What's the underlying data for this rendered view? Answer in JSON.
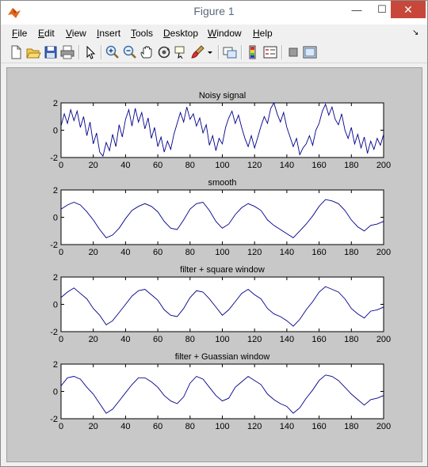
{
  "window": {
    "title": "Figure 1",
    "minimize_glyph": "—",
    "maximize_glyph": "☐",
    "close_glyph": "✕"
  },
  "menu": {
    "items": [
      {
        "label": "File",
        "accel": "F"
      },
      {
        "label": "Edit",
        "accel": "E"
      },
      {
        "label": "View",
        "accel": "V"
      },
      {
        "label": "Insert",
        "accel": "I"
      },
      {
        "label": "Tools",
        "accel": "T"
      },
      {
        "label": "Desktop",
        "accel": "D"
      },
      {
        "label": "Window",
        "accel": "W"
      },
      {
        "label": "Help",
        "accel": "H"
      }
    ],
    "overflow_glyph": "↘"
  },
  "toolbar": {
    "icons": [
      "new-figure-icon",
      "open-file-icon",
      "save-icon",
      "print-icon",
      "edit-plot-arrow-icon",
      "zoom-in-icon",
      "zoom-out-icon",
      "pan-hand-icon",
      "rotate-3d-icon",
      "data-cursor-icon",
      "brush-icon",
      "brush-dropdown-icon",
      "link-plot-icon",
      "colorbar-icon",
      "legend-icon",
      "hide-plot-tools-icon",
      "show-plot-tools-icon"
    ]
  },
  "colors": {
    "line": "#00008b",
    "figure_bg": "#c8c8c8",
    "axes_bg": "#ffffff",
    "close_button": "#c7473b"
  },
  "chart_data": [
    {
      "type": "line",
      "title": "Noisy signal",
      "xlim": [
        0,
        200
      ],
      "ylim": [
        -2,
        2
      ],
      "xticks": [
        0,
        20,
        40,
        60,
        80,
        100,
        120,
        140,
        160,
        180,
        200
      ],
      "yticks": [
        -2,
        0,
        2
      ],
      "series": [
        {
          "x": [
            0,
            2,
            4,
            6,
            8,
            10,
            12,
            14,
            16,
            18,
            20,
            22,
            24,
            26,
            28,
            30,
            32,
            34,
            36,
            38,
            40,
            42,
            44,
            46,
            48,
            50,
            52,
            54,
            56,
            58,
            60,
            62,
            64,
            66,
            68,
            70,
            72,
            74,
            76,
            78,
            80,
            82,
            84,
            86,
            88,
            90,
            92,
            94,
            96,
            98,
            100,
            102,
            104,
            106,
            108,
            110,
            112,
            114,
            116,
            118,
            120,
            122,
            124,
            126,
            128,
            130,
            132,
            134,
            136,
            138,
            140,
            142,
            144,
            146,
            148,
            150,
            152,
            154,
            156,
            158,
            160,
            162,
            164,
            166,
            168,
            170,
            172,
            174,
            176,
            178,
            180,
            182,
            184,
            186,
            188,
            190,
            192,
            194,
            196,
            198,
            200
          ],
          "y": [
            0.3,
            1.2,
            0.5,
            1.5,
            0.7,
            1.4,
            0.2,
            1.0,
            -0.4,
            0.6,
            -1.0,
            -0.2,
            -1.6,
            -1.9,
            -0.9,
            -1.5,
            -0.3,
            -1.2,
            0.4,
            -0.5,
            0.8,
            1.5,
            0.3,
            1.6,
            0.6,
            1.3,
            0.1,
            0.9,
            -0.6,
            0.2,
            -1.2,
            -0.5,
            -1.6,
            -0.8,
            -1.4,
            -0.3,
            0.5,
            1.3,
            0.6,
            1.7,
            0.8,
            1.2,
            0.3,
            0.9,
            -0.2,
            0.4,
            -1.1,
            -0.4,
            -1.5,
            -0.6,
            -1.0,
            0.2,
            0.9,
            1.4,
            0.5,
            1.1,
            0.2,
            -0.6,
            -1.2,
            -0.4,
            -1.3,
            -0.5,
            0.3,
            1.0,
            0.5,
            1.6,
            2.0,
            1.2,
            0.6,
            1.3,
            0.2,
            -0.5,
            -1.2,
            -0.6,
            -1.8,
            -1.3,
            -1.0,
            -0.4,
            -1.1,
            0.0,
            0.5,
            1.4,
            1.9,
            1.1,
            1.7,
            0.8,
            0.4,
            1.2,
            0.0,
            -0.6,
            0.2,
            -1.0,
            -0.3,
            -1.3,
            -0.5,
            -1.7,
            -0.8,
            -1.4,
            -0.6,
            -1.1,
            -0.3
          ]
        }
      ]
    },
    {
      "type": "line",
      "title": "smooth",
      "xlim": [
        0,
        200
      ],
      "ylim": [
        -2,
        2
      ],
      "xticks": [
        0,
        20,
        40,
        60,
        80,
        100,
        120,
        140,
        160,
        180,
        200
      ],
      "yticks": [
        -2,
        0,
        2
      ],
      "series": [
        {
          "x": [
            0,
            4,
            8,
            12,
            16,
            20,
            24,
            28,
            32,
            36,
            40,
            44,
            48,
            52,
            56,
            60,
            64,
            68,
            72,
            76,
            80,
            84,
            88,
            92,
            96,
            100,
            104,
            108,
            112,
            116,
            120,
            124,
            128,
            132,
            136,
            140,
            144,
            148,
            152,
            156,
            160,
            164,
            168,
            172,
            176,
            180,
            184,
            188,
            192,
            196,
            200
          ],
          "y": [
            0.6,
            0.9,
            1.1,
            0.9,
            0.4,
            -0.2,
            -0.9,
            -1.5,
            -1.3,
            -0.8,
            -0.1,
            0.5,
            0.8,
            1.0,
            0.8,
            0.4,
            -0.3,
            -0.8,
            -0.9,
            -0.2,
            0.6,
            1.0,
            1.1,
            0.5,
            -0.3,
            -0.8,
            -0.5,
            0.2,
            0.7,
            1.0,
            0.8,
            0.5,
            -0.2,
            -0.6,
            -0.9,
            -1.2,
            -1.5,
            -1.0,
            -0.5,
            0.1,
            0.8,
            1.3,
            1.2,
            1.0,
            0.5,
            -0.2,
            -0.7,
            -1.0,
            -0.6,
            -0.5,
            -0.3
          ]
        }
      ]
    },
    {
      "type": "line",
      "title": "filter + square window",
      "xlim": [
        0,
        200
      ],
      "ylim": [
        -2,
        2
      ],
      "xticks": [
        0,
        20,
        40,
        60,
        80,
        100,
        120,
        140,
        160,
        180,
        200
      ],
      "yticks": [
        -2,
        0,
        2
      ],
      "series": [
        {
          "x": [
            0,
            4,
            8,
            12,
            16,
            20,
            24,
            28,
            32,
            36,
            40,
            44,
            48,
            52,
            56,
            60,
            64,
            68,
            72,
            76,
            80,
            84,
            88,
            92,
            96,
            100,
            104,
            108,
            112,
            116,
            120,
            124,
            128,
            132,
            136,
            140,
            144,
            148,
            152,
            156,
            160,
            164,
            168,
            172,
            176,
            180,
            184,
            188,
            192,
            196,
            200
          ],
          "y": [
            0.5,
            0.9,
            1.2,
            0.8,
            0.4,
            -0.3,
            -0.8,
            -1.5,
            -1.2,
            -0.6,
            0.0,
            0.6,
            1.0,
            1.1,
            0.7,
            0.3,
            -0.4,
            -0.8,
            -0.9,
            -0.3,
            0.5,
            1.0,
            0.9,
            0.4,
            -0.2,
            -0.8,
            -0.4,
            0.2,
            0.8,
            1.1,
            0.7,
            0.4,
            -0.3,
            -0.7,
            -0.9,
            -1.2,
            -1.6,
            -1.1,
            -0.4,
            0.2,
            0.9,
            1.3,
            1.1,
            0.9,
            0.4,
            -0.3,
            -0.7,
            -1.0,
            -0.5,
            -0.4,
            -0.2
          ]
        }
      ]
    },
    {
      "type": "line",
      "title": "filter + Guassian window",
      "xlim": [
        0,
        200
      ],
      "ylim": [
        -2,
        2
      ],
      "xticks": [
        0,
        20,
        40,
        60,
        80,
        100,
        120,
        140,
        160,
        180,
        200
      ],
      "yticks": [
        -2,
        0,
        2
      ],
      "series": [
        {
          "x": [
            0,
            4,
            8,
            12,
            16,
            20,
            24,
            28,
            32,
            36,
            40,
            44,
            48,
            52,
            56,
            60,
            64,
            68,
            72,
            76,
            80,
            84,
            88,
            92,
            96,
            100,
            104,
            108,
            112,
            116,
            120,
            124,
            128,
            132,
            136,
            140,
            144,
            148,
            152,
            156,
            160,
            164,
            168,
            172,
            176,
            180,
            184,
            188,
            192,
            196,
            200
          ],
          "y": [
            0.4,
            1.0,
            1.1,
            0.9,
            0.3,
            -0.2,
            -0.9,
            -1.6,
            -1.3,
            -0.7,
            -0.1,
            0.5,
            1.0,
            1.0,
            0.7,
            0.3,
            -0.3,
            -0.7,
            -0.9,
            -0.4,
            0.6,
            1.1,
            0.9,
            0.3,
            -0.3,
            -0.7,
            -0.5,
            0.3,
            0.7,
            1.1,
            0.8,
            0.5,
            -0.2,
            -0.6,
            -0.9,
            -1.1,
            -1.6,
            -1.2,
            -0.5,
            0.1,
            0.8,
            1.2,
            1.1,
            0.8,
            0.3,
            -0.2,
            -0.6,
            -1.0,
            -0.6,
            -0.5,
            -0.3
          ]
        }
      ]
    }
  ]
}
